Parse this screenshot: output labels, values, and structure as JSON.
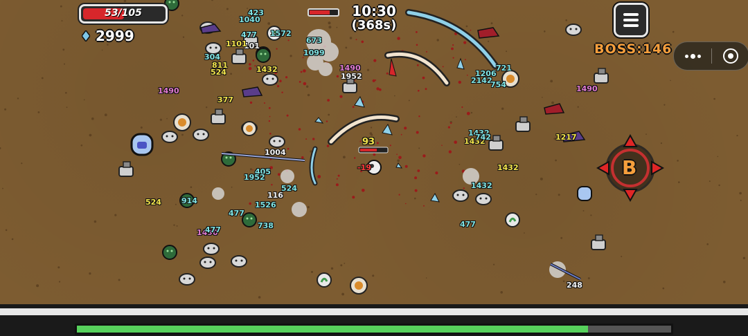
{
  "hud": {
    "hp_text": "53/105",
    "hp_fraction": 0.505,
    "gem_count": "2999",
    "timer_clock": "10:30",
    "timer_seconds": "(368s)",
    "boss_label": "BOSS:146",
    "xp_fraction": 0.86,
    "colors": {
      "hp": "#d7262b",
      "xp": "#57d15c",
      "boss": "#f59e3c",
      "ground": "#7d5c31"
    }
  },
  "icons": {
    "gem": "diamond-gem-icon",
    "menu": "hamburger-menu-icon",
    "more": "more-dots-icon",
    "close": "target-circle-icon",
    "boss_marker": "boss-b-marker-icon"
  },
  "boss_marker_letter": "B",
  "player_hit_number": "93",
  "damage_numbers": [
    {
      "text": "423",
      "color": "cyan"
    },
    {
      "text": "1040",
      "color": "cyan"
    },
    {
      "text": "477",
      "color": "cyan"
    },
    {
      "text": "101",
      "color": "white"
    },
    {
      "text": "1101",
      "color": "yellow"
    },
    {
      "text": "1572",
      "color": "cyan"
    },
    {
      "text": "304",
      "color": "cyan"
    },
    {
      "text": "811",
      "color": "yellow"
    },
    {
      "text": "524",
      "color": "yellow"
    },
    {
      "text": "1432",
      "color": "yellow"
    },
    {
      "text": "1490",
      "color": "pink"
    },
    {
      "text": "377",
      "color": "yellow"
    },
    {
      "text": "1490",
      "color": "pink"
    },
    {
      "text": "1952",
      "color": "white"
    },
    {
      "text": "673",
      "color": "cyan"
    },
    {
      "text": "1099",
      "color": "cyan"
    },
    {
      "text": "2142",
      "color": "cyan"
    },
    {
      "text": "754",
      "color": "cyan"
    },
    {
      "text": "721",
      "color": "cyan"
    },
    {
      "text": "1206",
      "color": "cyan"
    },
    {
      "text": "1490",
      "color": "pink"
    },
    {
      "text": "1217",
      "color": "yellow"
    },
    {
      "text": "1432",
      "color": "yellow"
    },
    {
      "text": "1432",
      "color": "cyan"
    },
    {
      "text": "524",
      "color": "yellow"
    },
    {
      "text": "1526",
      "color": "cyan"
    },
    {
      "text": "477",
      "color": "cyan"
    },
    {
      "text": "116",
      "color": "white"
    },
    {
      "text": "405",
      "color": "cyan"
    },
    {
      "text": "1952",
      "color": "cyan"
    },
    {
      "text": "524",
      "color": "cyan"
    },
    {
      "text": "1004",
      "color": "white"
    },
    {
      "text": "1490",
      "color": "pink"
    },
    {
      "text": "477",
      "color": "cyan"
    },
    {
      "text": "738",
      "color": "cyan"
    },
    {
      "text": "477",
      "color": "cyan"
    },
    {
      "text": "248",
      "color": "white"
    },
    {
      "text": "-19",
      "color": "red"
    },
    {
      "text": "1432",
      "color": "yellow"
    },
    {
      "text": "1432",
      "color": "cyan"
    },
    {
      "text": "742",
      "color": "cyan"
    },
    {
      "text": "914",
      "color": "cyan"
    }
  ]
}
